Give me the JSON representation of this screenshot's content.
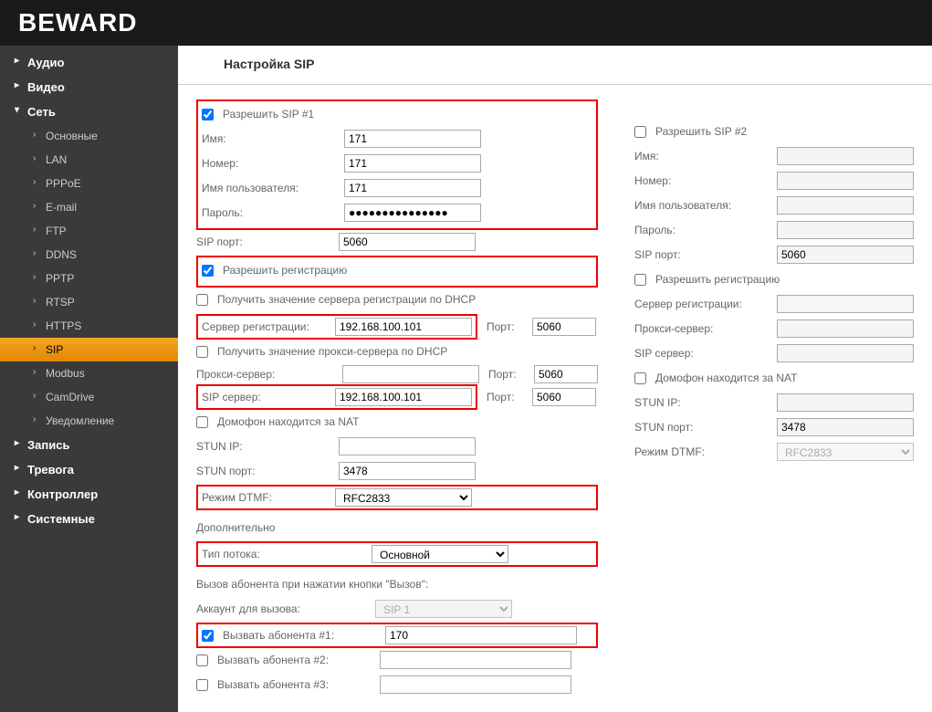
{
  "logo": "BEWARD",
  "page_title": "Настройка SIP",
  "nav": {
    "audio": "Аудио",
    "video": "Видео",
    "network": "Сеть",
    "basic": "Основные",
    "lan": "LAN",
    "pppoe": "PPPoE",
    "email": "E-mail",
    "ftp": "FTP",
    "ddns": "DDNS",
    "pptp": "PPTP",
    "rtsp": "RTSP",
    "https": "HTTPS",
    "sip": "SIP",
    "modbus": "Modbus",
    "camdrive": "CamDrive",
    "notify": "Уведомление",
    "record": "Запись",
    "alarm": "Тревога",
    "controller": "Контроллер",
    "system": "Системные"
  },
  "sip1": {
    "enable": "Разрешить SIP #1",
    "name_lbl": "Имя:",
    "name": "171",
    "number_lbl": "Номер:",
    "number": "171",
    "user_lbl": "Имя пользователя:",
    "user": "171",
    "pass_lbl": "Пароль:",
    "pass": "●●●●●●●●●●●●●●●",
    "sipport_lbl": "SIP порт:",
    "sipport": "5060",
    "enable_reg": "Разрешить регистрацию",
    "reg_dhcp": "Получить значение сервера регистрации по DHCP",
    "regsrv_lbl": "Сервер регистрации:",
    "regsrv": "192.168.100.101",
    "port_lbl": "Порт:",
    "regport": "5060",
    "proxy_dhcp": "Получить значение прокси-сервера по DHCP",
    "proxy_lbl": "Прокси-сервер:",
    "proxy": "",
    "proxyport": "5060",
    "sipsrv_lbl": "SIP сервер:",
    "sipsrv": "192.168.100.101",
    "sipsrvport": "5060",
    "nat": "Домофон находится за NAT",
    "stunip_lbl": "STUN IP:",
    "stunip": "",
    "stunport_lbl": "STUN порт:",
    "stunport": "3478",
    "dtmf_lbl": "Режим DTMF:",
    "dtmf": "RFC2833"
  },
  "sip2": {
    "enable": "Разрешить SIP #2",
    "name_lbl": "Имя:",
    "number_lbl": "Номер:",
    "user_lbl": "Имя пользователя:",
    "pass_lbl": "Пароль:",
    "sipport_lbl": "SIP порт:",
    "sipport": "5060",
    "enable_reg": "Разрешить регистрацию",
    "regsrv_lbl": "Сервер регистрации:",
    "proxy_lbl": "Прокси-сервер:",
    "sipsrv_lbl": "SIP сервер:",
    "nat": "Домофон находится за NAT",
    "stunip_lbl": "STUN IP:",
    "stunport_lbl": "STUN порт:",
    "stunport": "3478",
    "dtmf_lbl": "Режим DTMF:",
    "dtmf": "RFC2833"
  },
  "extra": {
    "title": "Дополнительно",
    "stream_lbl": "Тип потока:",
    "stream": "Основной",
    "call_btn_title": "Вызов абонента при нажатии кнопки \"Вызов\":",
    "account_lbl": "Аккаунт для вызова:",
    "account": "SIP 1",
    "call1_lbl": "Вызвать абонента #1:",
    "call1": "170",
    "call2_lbl": "Вызвать абонента #2:",
    "call2": "",
    "call3_lbl": "Вызвать абонента #3:",
    "call3": ""
  }
}
